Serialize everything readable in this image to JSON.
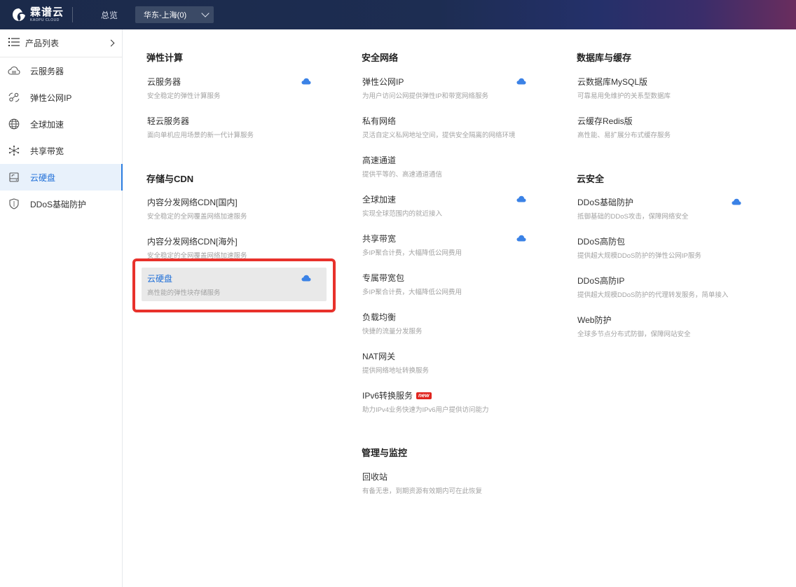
{
  "topbar": {
    "logo_cn": "霖谱云",
    "logo_en": "KAOPU CLOUD",
    "overview": "总览",
    "region": "华东-上海(0)"
  },
  "sidebar": {
    "header": "产品列表",
    "items": [
      {
        "label": "云服务器",
        "icon": "cloud-server-icon"
      },
      {
        "label": "弹性公网IP",
        "icon": "elastic-ip-icon"
      },
      {
        "label": "全球加速",
        "icon": "globe-icon"
      },
      {
        "label": "共享带宽",
        "icon": "network-hub-icon"
      },
      {
        "label": "云硬盘",
        "icon": "disk-icon",
        "active": true
      },
      {
        "label": "DDoS基础防护",
        "icon": "shield-icon"
      }
    ]
  },
  "categories": {
    "compute": {
      "title": "弹性计算",
      "products": [
        {
          "name": "云服务器",
          "desc": "安全稳定的弹性计算服务",
          "cloud": true
        },
        {
          "name": "轻云服务器",
          "desc": "面向单机应用场景的新一代计算服务",
          "cloud": false
        }
      ]
    },
    "storage": {
      "title": "存储与CDN",
      "products": [
        {
          "name": "内容分发网络CDN[国内]",
          "desc": "安全稳定的全网覆盖网络加速服务",
          "cloud": false
        },
        {
          "name": "内容分发网络CDN[海外]",
          "desc": "安全稳定的全网覆盖网络加速服务",
          "cloud": false
        },
        {
          "name": "云硬盘",
          "desc": "高性能的弹性块存储服务",
          "cloud": true
        }
      ]
    },
    "network": {
      "title": "安全网络",
      "products": [
        {
          "name": "弹性公网IP",
          "desc": "为用户访问公网提供弹性IP和带宽网络服务",
          "cloud": true
        },
        {
          "name": "私有网络",
          "desc": "灵活自定义私网地址空间，提供安全隔离的网络环境",
          "cloud": false
        },
        {
          "name": "高速通道",
          "desc": "提供平等的、高速通道通信",
          "cloud": false
        },
        {
          "name": "全球加速",
          "desc": "实现全球范围内的就近接入",
          "cloud": true
        },
        {
          "name": "共享带宽",
          "desc": "多IP聚合计费，大幅降低公网费用",
          "cloud": true
        },
        {
          "name": "专属带宽包",
          "desc": "多IP聚合计费，大幅降低公网费用",
          "cloud": false
        },
        {
          "name": "负载均衡",
          "desc": "快捷的流量分发服务",
          "cloud": false
        },
        {
          "name": "NAT网关",
          "desc": "提供网络地址转换服务",
          "cloud": false
        },
        {
          "name": "IPv6转换服务",
          "desc": "助力IPv4业务快速为IPv6用户提供访问能力",
          "cloud": false,
          "badge": "new"
        }
      ]
    },
    "management": {
      "title": "管理与监控",
      "products": [
        {
          "name": "回收站",
          "desc": "有备无患，到期资源有效期内可在此恢复",
          "cloud": false
        }
      ]
    },
    "database": {
      "title": "数据库与缓存",
      "products": [
        {
          "name": "云数据库MySQL版",
          "desc": "可靠易用免维护的关系型数据库",
          "cloud": false
        },
        {
          "name": "云缓存Redis版",
          "desc": "高性能、易扩展分布式缓存服务",
          "cloud": false
        }
      ]
    },
    "security": {
      "title": "云安全",
      "products": [
        {
          "name": "DDoS基础防护",
          "desc": "抵御基础的DDoS攻击，保障网络安全",
          "cloud": true
        },
        {
          "name": "DDoS高防包",
          "desc": "提供超大规模DDoS防护的弹性公网IP服务",
          "cloud": false
        },
        {
          "name": "DDoS高防IP",
          "desc": "提供超大规模DDoS防护的代理转发服务，简单接入",
          "cloud": false
        },
        {
          "name": "Web防护",
          "desc": "全球多节点分布式防御，保障网站安全",
          "cloud": false
        }
      ]
    }
  },
  "colors": {
    "accent": "#1f6fd8",
    "highlight_border": "#e8312b",
    "cloud_icon": "#3b82e6"
  }
}
